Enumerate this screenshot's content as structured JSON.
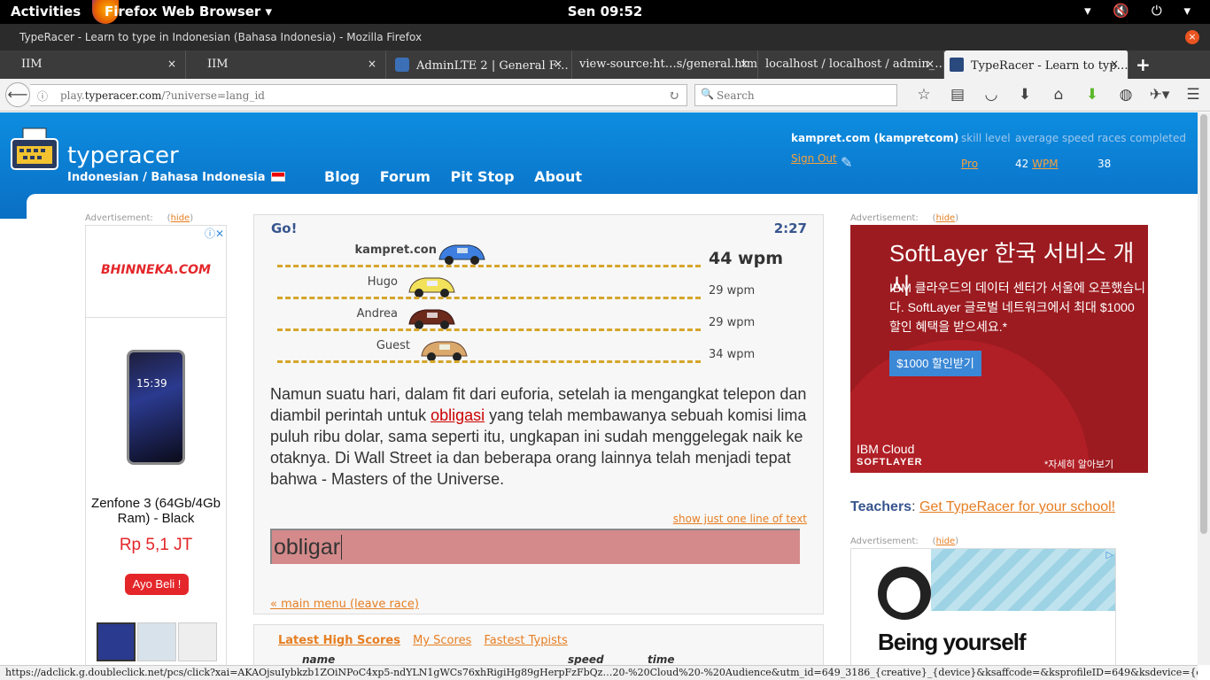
{
  "gnome": {
    "activities": "Activities",
    "app_menu": "Firefox Web Browser ▾",
    "clock": "Sen 09:52",
    "tray": "▾ 🔇 ⏻ ▾"
  },
  "window": {
    "title": "TypeRacer - Learn to type in Indonesian (Bahasa Indonesia) - Mozilla Firefox",
    "close": "×"
  },
  "tabs": [
    {
      "label": "IIM",
      "close": "×"
    },
    {
      "label": "IIM",
      "close": "×"
    },
    {
      "label": "AdminLTE 2 | General F…",
      "close": "×"
    },
    {
      "label": "view-source:ht…s/general.html",
      "close": "×"
    },
    {
      "label": "localhost / localhost / admin_…",
      "close": "×"
    },
    {
      "label": "TypeRacer - Learn to typ…",
      "close": "×"
    }
  ],
  "new_tab": "+",
  "nav": {
    "back": "⟵",
    "url_prefix": "play.",
    "url_domain": "typeracer.com",
    "url_rest": "/?universe=lang_id",
    "search_placeholder": "Search",
    "icons": [
      "star-icon",
      "reader-icon",
      "pocket-icon",
      "download-icon",
      "home-icon",
      "green-download-icon",
      "vpn-icon",
      "extension-icon",
      "menu-icon"
    ]
  },
  "site": {
    "brand": "typeracer",
    "universe": "Indonesian / Bahasa Indonesia",
    "links": [
      "Blog",
      "Forum",
      "Pit Stop",
      "About"
    ],
    "user": "kampret.com (kampretcom)",
    "signout": "Sign Out",
    "stat_heads": [
      "skill level",
      "average speed",
      "races completed"
    ],
    "skill": "Pro",
    "avg_speed": "42",
    "avg_unit": "WPM",
    "races": "38"
  },
  "ads": {
    "label": "Advertisement:",
    "hide": "hide",
    "left": {
      "brand": "BHINNEKA.COM",
      "phone_time": "15:39",
      "product": "Zenfone 3 (64Gb/4Gb Ram) - Black",
      "price": "Rp 5,1 JT",
      "cta": "Ayo Beli !"
    },
    "right": {
      "title": "SoftLayer 한국 서비스 개시",
      "body": "IBM 클라우드의 데이터 센터가 서울에 오픈했습니다. SoftLayer 글로벌 네트워크에서 최대 $1000 할인 혜택을 받으세요.*",
      "cta": "$1000 할인받기",
      "ibm": "IBM Cloud",
      "softlayer": "SOFTLAYER",
      "more": "*자세히 알아보기"
    },
    "right2": {
      "headline": "Being yourself"
    }
  },
  "race": {
    "status": "Go!",
    "timer": "2:27",
    "racers": [
      {
        "name": "kampret.con",
        "wpm": "44 wpm",
        "color": "#3d7fe0"
      },
      {
        "name": "Hugo",
        "wpm": "29 wpm",
        "color": "#f2e15a"
      },
      {
        "name": "Andrea",
        "wpm": "29 wpm",
        "color": "#6b2a1c"
      },
      {
        "name": "Guest",
        "wpm": "34 wpm",
        "color": "#d9a86a"
      }
    ],
    "text_before": "Namun suatu hari, dalam fit dari euforia, setelah ia mengangkat telepon dan diambil perintah untuk ",
    "text_current": "obligasi",
    "text_after": " yang telah membawanya sebuah komisi lima puluh ribu dolar, sama seperti itu, ungkapan ini sudah menggelegak naik ke otaknya. Di Wall Street ia dan beberapa orang lainnya telah menjadi tepat bahwa - Masters of the Universe.",
    "one_line": "show just one line of text",
    "input_value": "obligar",
    "leave": "« main menu (leave race)"
  },
  "teachers": {
    "label": "Teachers",
    "colon": ": ",
    "link": "Get TypeRacer for your school!"
  },
  "scores": {
    "tabs": [
      "Latest High Scores",
      "My Scores",
      "Fastest Typists"
    ],
    "cols": [
      "name",
      "speed",
      "time"
    ]
  },
  "status_url": "https://adclick.g.doubleclick.net/pcs/click?xai=AKAOjsuIybkzb1ZOiNPoC4xp5-ndYLN1gWCs76xhRigiHg89gHerpFzFbQz…20-%20Cloud%20-%20Audience&utm_id=649_3186_{creative}_{device}&ksaffcode=&ksprofileID=649&ksdevice={device}"
}
